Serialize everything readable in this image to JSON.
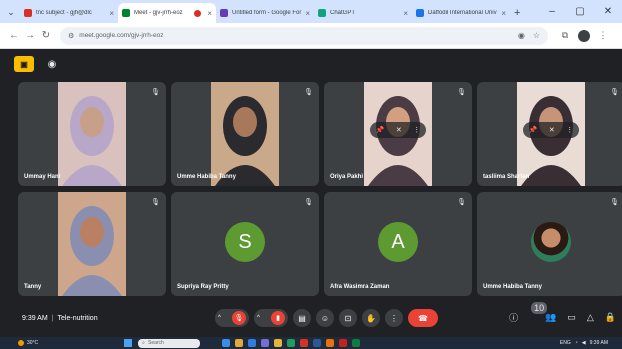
{
  "browser": {
    "tabs": [
      {
        "title": "tnc subject - gjh@dlc",
        "favicon_color": "#d93025",
        "active": false,
        "recording": false
      },
      {
        "title": "Meet - gjv-jrrh-eoz",
        "favicon_color": "#00832d",
        "active": true,
        "recording": true
      },
      {
        "title": "Untitled form - Google For",
        "favicon_color": "#673ab7",
        "active": false,
        "recording": false
      },
      {
        "title": "ChatGPT",
        "favicon_color": "#10a37f",
        "active": false,
        "recording": false
      },
      {
        "title": "Daffodil International Univ",
        "favicon_color": "#1a73e8",
        "active": false,
        "recording": false
      }
    ],
    "url": "meet.google.com/gjv-jrrh-eoz"
  },
  "participants": [
    {
      "name": "Ummay Hani",
      "type": "video",
      "skin": "#c8a08a",
      "cloth": "#b9a7c9",
      "bg": "#d9c2bd"
    },
    {
      "name": "Umme Habiba Tanny",
      "type": "video",
      "skin": "#a8785c",
      "cloth": "#2b2b2f",
      "bg": "#c9a98a"
    },
    {
      "name": "Oriya Pakhi",
      "type": "video",
      "skin": "#d29f80",
      "cloth": "#4a3b44",
      "bg": "#e6d4cc",
      "pinned_overlay": true
    },
    {
      "name": "tasliima Shartan",
      "type": "video",
      "skin": "#c59479",
      "cloth": "#3a2e35",
      "bg": "#e8dcd4",
      "pinned_overlay": true
    },
    {
      "name": "Tanny",
      "type": "video",
      "skin": "#b98063",
      "cloth": "#8a8fb0",
      "bg": "#cda68c"
    },
    {
      "name": "Supriya Ray Pritty",
      "type": "avatar",
      "initial": "S",
      "color": "#5e9a32"
    },
    {
      "name": "Afra Wasimra Zaman",
      "type": "avatar",
      "initial": "A",
      "color": "#5e9a32"
    },
    {
      "name": "Umme Habiba Tanny",
      "type": "photo"
    }
  ],
  "meeting": {
    "time": "9:39 AM",
    "name": "Tele-nutrition",
    "participant_count": "10"
  },
  "taskbar": {
    "weather": "30°C",
    "search_placeholder": "Search",
    "language": "ENG",
    "clock": "9:39 AM"
  }
}
